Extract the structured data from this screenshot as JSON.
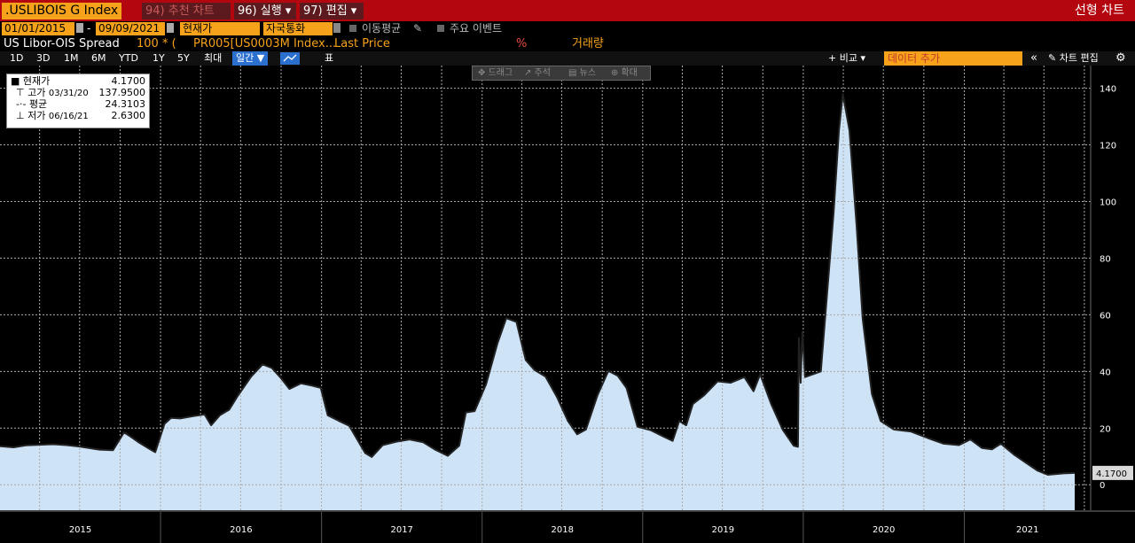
{
  "header": {
    "ticker": ".USLIBOIS G Index",
    "btn_recent": "94) 추천 차트",
    "btn_run": "96) 실행 ▾",
    "btn_edit": "97) 편집 ▾",
    "chart_name": "선형 차트"
  },
  "controls": {
    "start_date": "01/01/2015",
    "dash": "-",
    "end_date": "09/09/2021",
    "field": "현재가",
    "currency": "자국통화",
    "moving_avg": "이동평균",
    "events": "주요 이벤트"
  },
  "series_row": {
    "name": "US Libor-OIS Spread",
    "formula": "100 * (",
    "expr": "PR005[US0003M Index...",
    "last_price": "Last Price",
    "pct": "%",
    "volume": "거래량"
  },
  "timeframes": [
    "1D",
    "3D",
    "1M",
    "6M",
    "YTD",
    "1Y",
    "5Y",
    "최대"
  ],
  "periodicity": "일간 ▼",
  "table_label": "표",
  "compare": "+ 비교 ▾",
  "add_data": "데이터 추가",
  "collapse": "«",
  "edit_chart": "차트 편집",
  "gear": "⚙",
  "toolbar": {
    "draw": "✥ 드래그",
    "annotate": "↗ 주석",
    "news": "▤ 뉴스",
    "zoom": "⊕ 확대"
  },
  "legend": {
    "last_label": "현재가",
    "last_value": "4.1700",
    "high_label": "고가",
    "high_date": "03/31/20",
    "high_value": "137.9500",
    "avg_label": "평균",
    "avg_value": "24.3103",
    "low_label": "저가",
    "low_date": "06/16/21",
    "low_value": "2.6300"
  },
  "colors": {
    "accent": "#f6a21b",
    "header": "#b4060f",
    "area": "#cfe3f7",
    "line": "#222222"
  },
  "chart_data": {
    "type": "area",
    "ylim": [
      -9,
      148
    ],
    "yticks": [
      0,
      20,
      40,
      60,
      80,
      100,
      120,
      140
    ],
    "xticks": [
      "2015",
      "2016",
      "2017",
      "2018",
      "2019",
      "2020",
      "2021"
    ],
    "x_range": [
      "2015-01-01",
      "2021-09-09"
    ],
    "last_value_label": "4.1700",
    "points": [
      [
        "2015-01-01",
        13.6
      ],
      [
        "2015-02-01",
        13.2
      ],
      [
        "2015-03-01",
        13.9
      ],
      [
        "2015-04-01",
        14.1
      ],
      [
        "2015-05-01",
        14.3
      ],
      [
        "2015-06-01",
        14.0
      ],
      [
        "2015-07-01",
        13.5
      ],
      [
        "2015-08-15",
        12.4
      ],
      [
        "2015-09-15",
        12.2
      ],
      [
        "2015-10-10",
        18.5
      ],
      [
        "2015-10-25",
        17.0
      ],
      [
        "2015-11-10",
        15.2
      ],
      [
        "2015-12-05",
        12.8
      ],
      [
        "2015-12-20",
        11.5
      ],
      [
        "2016-01-10",
        21.5
      ],
      [
        "2016-01-25",
        23.6
      ],
      [
        "2016-02-15",
        23.4
      ],
      [
        "2016-03-15",
        24.2
      ],
      [
        "2016-04-10",
        24.8
      ],
      [
        "2016-04-25",
        21.0
      ],
      [
        "2016-05-15",
        24.6
      ],
      [
        "2016-06-05",
        26.5
      ],
      [
        "2016-06-25",
        31.5
      ],
      [
        "2016-07-25",
        38.2
      ],
      [
        "2016-08-20",
        42.5
      ],
      [
        "2016-09-10",
        41.2
      ],
      [
        "2016-09-30",
        37.8
      ],
      [
        "2016-10-20",
        33.8
      ],
      [
        "2016-11-15",
        35.8
      ],
      [
        "2016-12-10",
        35.0
      ],
      [
        "2016-12-30",
        34.2
      ],
      [
        "2017-01-15",
        24.5
      ],
      [
        "2017-02-10",
        22.5
      ],
      [
        "2017-03-05",
        20.8
      ],
      [
        "2017-03-25",
        15.5
      ],
      [
        "2017-04-10",
        11.2
      ],
      [
        "2017-04-25",
        9.8
      ],
      [
        "2017-05-20",
        14.0
      ],
      [
        "2017-06-20",
        15.2
      ],
      [
        "2017-07-20",
        16.0
      ],
      [
        "2017-08-20",
        15.0
      ],
      [
        "2017-09-15",
        12.5
      ],
      [
        "2017-10-15",
        10.2
      ],
      [
        "2017-11-10",
        13.8
      ],
      [
        "2017-11-25",
        25.5
      ],
      [
        "2017-12-15",
        26.0
      ],
      [
        "2018-01-10",
        35.5
      ],
      [
        "2018-02-05",
        50.0
      ],
      [
        "2018-02-25",
        58.8
      ],
      [
        "2018-03-20",
        57.5
      ],
      [
        "2018-04-10",
        44.0
      ],
      [
        "2018-04-30",
        40.5
      ],
      [
        "2018-05-25",
        38.2
      ],
      [
        "2018-06-20",
        31.0
      ],
      [
        "2018-07-15",
        22.5
      ],
      [
        "2018-08-05",
        17.8
      ],
      [
        "2018-08-25",
        19.5
      ],
      [
        "2018-09-20",
        31.5
      ],
      [
        "2018-10-15",
        40.2
      ],
      [
        "2018-11-05",
        38.5
      ],
      [
        "2018-11-25",
        34.2
      ],
      [
        "2018-12-20",
        20.5
      ],
      [
        "2019-01-20",
        19.2
      ],
      [
        "2019-02-20",
        16.8
      ],
      [
        "2019-03-10",
        15.5
      ],
      [
        "2019-03-25",
        22.5
      ],
      [
        "2019-04-10",
        21.0
      ],
      [
        "2019-04-25",
        28.5
      ],
      [
        "2019-05-20",
        31.5
      ],
      [
        "2019-06-20",
        36.5
      ],
      [
        "2019-07-20",
        36.0
      ],
      [
        "2019-08-20",
        38.0
      ],
      [
        "2019-09-10",
        33.0
      ],
      [
        "2019-09-25",
        39.0
      ],
      [
        "2019-10-20",
        28.5
      ],
      [
        "2019-11-15",
        19.5
      ],
      [
        "2019-12-10",
        13.8
      ],
      [
        "2019-12-20",
        13.4
      ],
      [
        "2019-12-22",
        51.8
      ],
      [
        "2019-12-26",
        36.0
      ],
      [
        "2019-12-30",
        54.0
      ],
      [
        "2020-01-05",
        38.0
      ],
      [
        "2020-02-10",
        40.0
      ],
      [
        "2020-03-10",
        96.0
      ],
      [
        "2020-03-22",
        125.0
      ],
      [
        "2020-03-31",
        137.95
      ],
      [
        "2020-04-15",
        125.0
      ],
      [
        "2020-05-01",
        92.0
      ],
      [
        "2020-05-15",
        58.5
      ],
      [
        "2020-06-05",
        32.0
      ],
      [
        "2020-06-25",
        22.5
      ],
      [
        "2020-07-25",
        19.5
      ],
      [
        "2020-09-01",
        18.8
      ],
      [
        "2020-10-10",
        16.5
      ],
      [
        "2020-11-15",
        14.5
      ],
      [
        "2020-12-20",
        14.0
      ],
      [
        "2021-01-15",
        16.0
      ],
      [
        "2021-02-10",
        13.0
      ],
      [
        "2021-03-05",
        12.5
      ],
      [
        "2021-03-25",
        14.5
      ],
      [
        "2021-04-25",
        10.5
      ],
      [
        "2021-06-16",
        5.0
      ],
      [
        "2021-07-10",
        3.5
      ],
      [
        "2021-08-15",
        4.0
      ],
      [
        "2021-09-09",
        4.17
      ]
    ]
  }
}
